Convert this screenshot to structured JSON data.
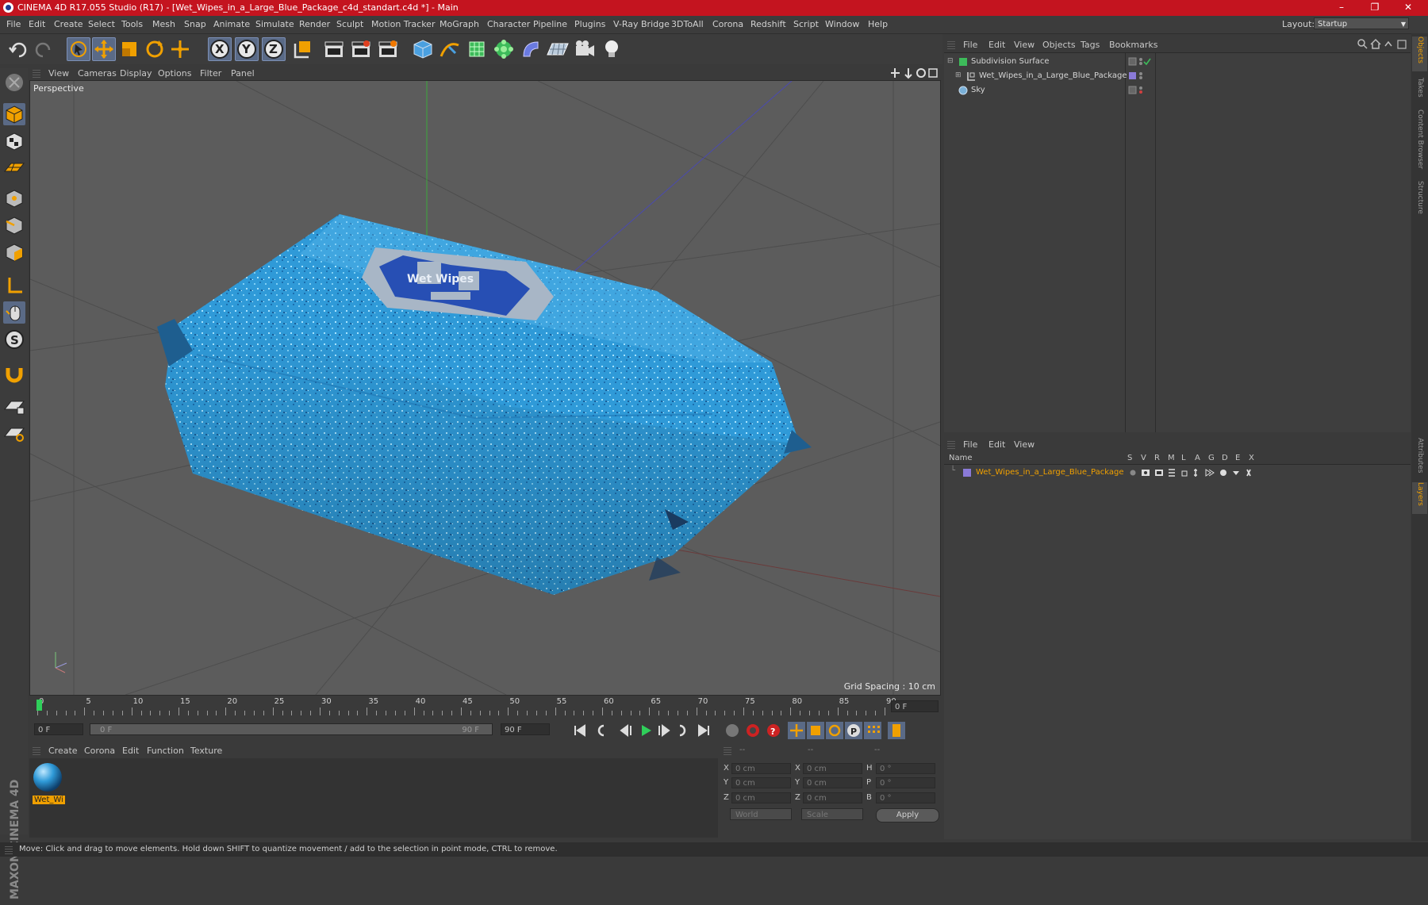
{
  "window": {
    "title": "CINEMA 4D R17.055 Studio (R17) - [Wet_Wipes_in_a_Large_Blue_Package_c4d_standart.c4d *] - Main",
    "controls": [
      "–",
      "❐",
      "✕"
    ]
  },
  "menubar": {
    "items": [
      "File",
      "Edit",
      "Create",
      "Select",
      "Tools",
      "Mesh",
      "Snap",
      "Animate",
      "Simulate",
      "Render",
      "Sculpt",
      "Motion Tracker",
      "MoGraph",
      "Character",
      "Pipeline",
      "Plugins",
      "V-Ray Bridge",
      "3DToAll",
      "Corona",
      "Redshift",
      "Script",
      "Window",
      "Help"
    ],
    "layout_label": "Layout:",
    "layout_value": "Startup"
  },
  "toolbar": {
    "axis_x": "X",
    "axis_y": "Y",
    "axis_z": "Z"
  },
  "viewport": {
    "menu": [
      "View",
      "Cameras",
      "Display",
      "Options",
      "Filter",
      "Panel"
    ],
    "camera_label": "Perspective",
    "grid_spacing": "Grid Spacing : 10 cm",
    "logo_text": "Wet Wipes"
  },
  "timeline": {
    "ticks": [
      "0",
      "5",
      "10",
      "15",
      "20",
      "25",
      "30",
      "35",
      "40",
      "45",
      "50",
      "55",
      "60",
      "65",
      "70",
      "75",
      "80",
      "85",
      "90"
    ],
    "current_frame": "0 F",
    "start_frame": "0 F",
    "range_start": "0 F",
    "range_end": "90 F",
    "end_frame": "90 F"
  },
  "material_manager": {
    "menu": [
      "Create",
      "Corona",
      "Edit",
      "Function",
      "Texture"
    ],
    "materials": [
      {
        "name": "Wet_Wi"
      }
    ]
  },
  "coordinates": {
    "header": [
      "--",
      "--",
      "--"
    ],
    "rows": [
      {
        "a": "X",
        "av": "0 cm",
        "b": "X",
        "bv": "0 cm",
        "c": "H",
        "cv": "0 °"
      },
      {
        "a": "Y",
        "av": "0 cm",
        "b": "Y",
        "bv": "0 cm",
        "c": "P",
        "cv": "0 °"
      },
      {
        "a": "Z",
        "av": "0 cm",
        "b": "Z",
        "bv": "0 cm",
        "c": "B",
        "cv": "0 °"
      }
    ],
    "space": "World",
    "mode": "Scale",
    "apply": "Apply"
  },
  "object_manager": {
    "menu": [
      "File",
      "Edit",
      "View",
      "Objects",
      "Tags",
      "Bookmarks"
    ],
    "objects": [
      {
        "name": "Subdivision Surface"
      },
      {
        "name": "Wet_Wipes_in_a_Large_Blue_Package"
      },
      {
        "name": "Sky"
      }
    ]
  },
  "layer_manager": {
    "menu": [
      "File",
      "Edit",
      "View"
    ],
    "columns": [
      "Name",
      "S",
      "V",
      "R",
      "M",
      "L",
      "A",
      "G",
      "D",
      "E",
      "X"
    ],
    "layers": [
      {
        "name": "Wet_Wipes_in_a_Large_Blue_Package",
        "color": "#8a7ad8"
      }
    ]
  },
  "side_tabs": [
    "Objects",
    "Takes",
    "Content Browser",
    "Structure",
    "Attributes",
    "Layers"
  ],
  "branding": "MAXON CINEMA 4D",
  "status": "Move: Click and drag to move elements. Hold down SHIFT to quantize movement / add to the selection in point mode, CTRL to remove.",
  "colors": {
    "title_bar": "#c4141f",
    "accent_orange": "#f0a000",
    "package_blue": "#2f9ad8"
  }
}
